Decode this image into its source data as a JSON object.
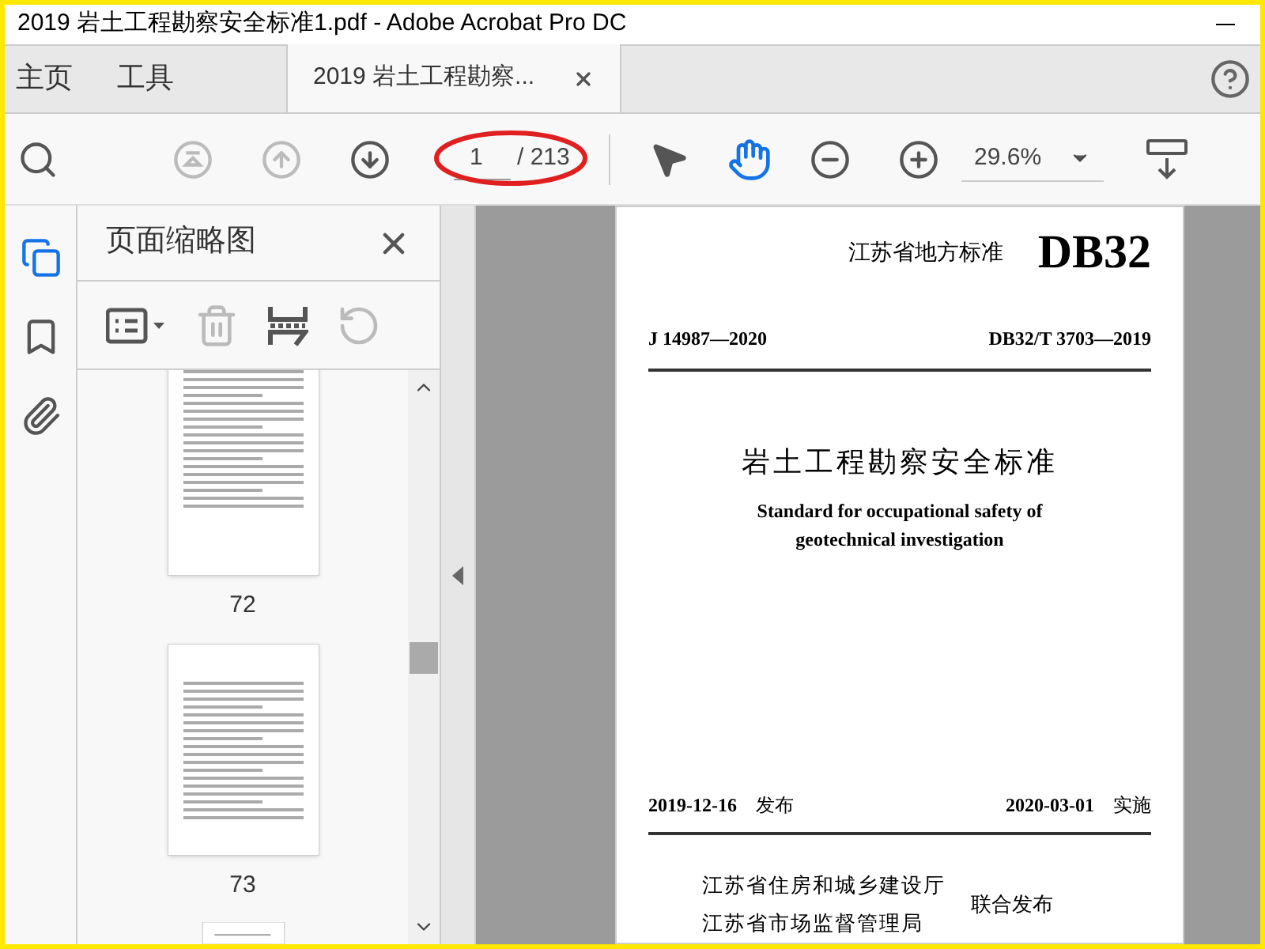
{
  "window": {
    "title": "2019 岩土工程勘察安全标准1.pdf - Adobe Acrobat Pro DC"
  },
  "tabs": [
    {
      "label": "主页",
      "selected": false,
      "closable": false
    },
    {
      "label": "工具",
      "selected": false,
      "closable": false
    },
    {
      "label": "2019 岩土工程勘察...",
      "selected": true,
      "closable": true
    }
  ],
  "toolbar": {
    "nav": [
      {
        "kind": "first",
        "disabled": true
      },
      {
        "kind": "prev",
        "disabled": true
      },
      {
        "kind": "next",
        "disabled": false
      }
    ],
    "page_input": "1",
    "page_total": "/ 213",
    "annotated": true,
    "tools": [
      {
        "kind": "pointer",
        "selected": false
      },
      {
        "kind": "hand",
        "selected": true
      }
    ],
    "zoom": "29.6%"
  },
  "rail": [
    {
      "kind": "pages",
      "selected": true
    },
    {
      "kind": "bookmark",
      "selected": false
    },
    {
      "kind": "attachment",
      "selected": false
    }
  ],
  "panel": {
    "title": "页面缩略图",
    "tools": [
      {
        "kind": "options",
        "disabled": false
      },
      {
        "kind": "delete",
        "disabled": true
      },
      {
        "kind": "extract",
        "disabled": false
      },
      {
        "kind": "rotate",
        "disabled": true
      }
    ],
    "thumbnails": [
      {
        "page": "72"
      },
      {
        "page": "73"
      }
    ]
  },
  "document": {
    "header": "江苏省地方标准",
    "code": "DB32",
    "left_number": "J 14987—2020",
    "right_number": "DB32/T 3703—2019",
    "title_zh": "岩土工程勘察安全标准",
    "title_en": [
      "Standard for occupational safety of",
      "geotechnical investigation"
    ],
    "publish_date": "2019-12-16",
    "publish_label": "发布",
    "effective_date": "2020-03-01",
    "effective_label": "实施",
    "issuers": [
      "江苏省住房和城乡建设厅",
      "江苏省市场监督管理局"
    ],
    "joint": "联合发布"
  }
}
